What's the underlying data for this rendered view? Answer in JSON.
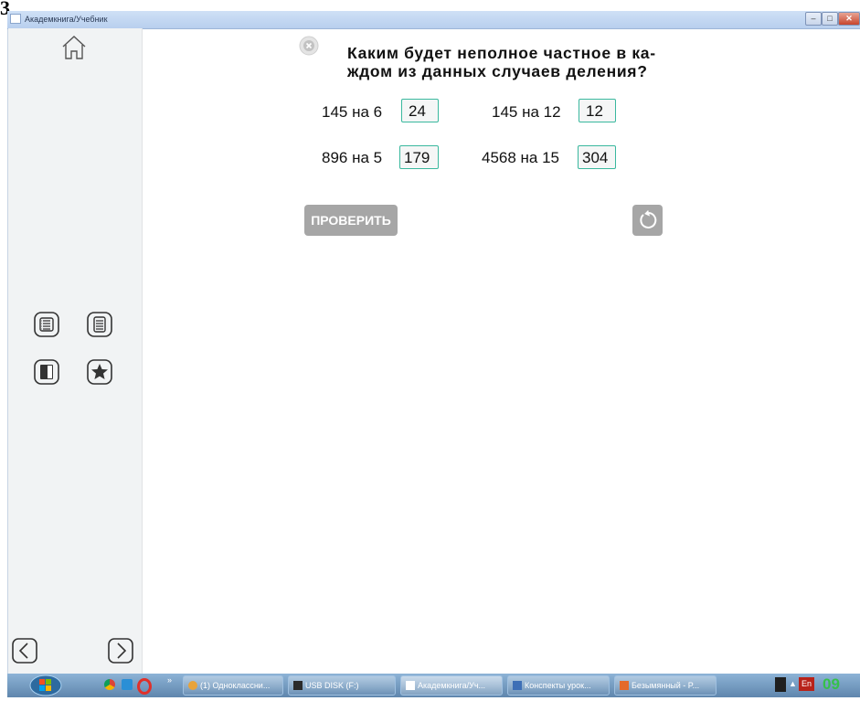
{
  "window": {
    "title": "Академкнига/Учебник",
    "controls": [
      "–",
      "□",
      "✕"
    ]
  },
  "heading_fragment": "3.",
  "sidebar": {
    "icons": [
      "home-icon",
      "contents-list-icon",
      "page-icon",
      "book-icon",
      "bookmark-star-icon",
      "prev-arrow-icon",
      "next-arrow-icon"
    ]
  },
  "task": {
    "question_line1": "Каким  будет  неполное  частное  в  ка-",
    "question_line2": "ждом  из  данных  случаев  деления?",
    "items": [
      {
        "label": "145 на 6",
        "answer": "24"
      },
      {
        "label": "145 на 12",
        "answer": "12"
      },
      {
        "label": "896 на 5",
        "answer": "179"
      },
      {
        "label": "4568 на 15",
        "answer": "304"
      }
    ],
    "check_button": "ПРОВЕРИТЬ"
  },
  "taskbar": {
    "tasks": [
      "(1) Одноклассни...",
      "USB DISK (F:)",
      "Академкнига/Уч...",
      "Конспекты урок...",
      "Безымянный - P..."
    ],
    "language": "En",
    "clock": "09"
  },
  "colors": {
    "accent": "#3ab89e",
    "button_gray": "#a6a6a6",
    "sidebar_bg": "#f1f3f4",
    "titlebar": "#c3d7f1",
    "taskbar": "#7aa0c6"
  }
}
